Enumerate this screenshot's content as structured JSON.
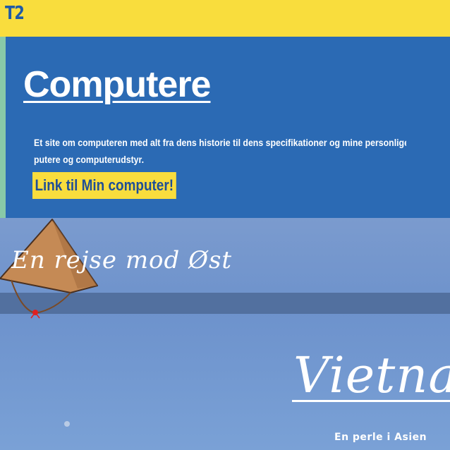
{
  "header": {
    "brand": "T2"
  },
  "hero": {
    "title": "Computere",
    "description_line1": "Et site om computeren med alt fra dens historie til dens specifikationer og mine personlige p",
    "description_line2": "putere og computerudstyr.",
    "cta_label": "Link til Min computer!"
  },
  "travel": {
    "journey_title": "En rejse mod Øst",
    "country": "Vietnam",
    "subtitle": "En perle i Asien",
    "hat_icon": "conical-hat-icon"
  },
  "colors": {
    "header_yellow": "#f9dd3d",
    "hero_blue": "#2b6ab4",
    "stripe_green": "#88c9a8",
    "cta_text": "#1f4e96",
    "band_blue": "#52709f",
    "hat_brown": "#c58a55"
  }
}
